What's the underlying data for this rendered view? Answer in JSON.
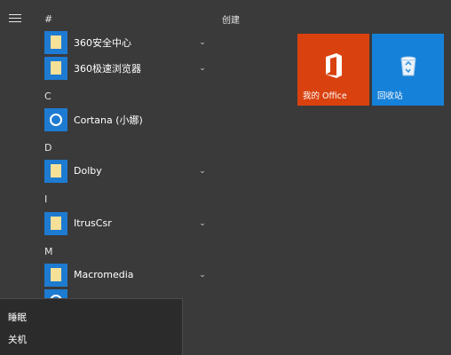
{
  "start": {
    "groups": [
      "#",
      "C",
      "D",
      "I",
      "M"
    ],
    "apps": [
      {
        "label": "360安全中心",
        "icon": "folder-icon",
        "expandable": true
      },
      {
        "label": "360极速浏览器",
        "icon": "folder-icon",
        "expandable": true
      },
      {
        "label": "Cortana (小娜)",
        "icon": "cortana-icon",
        "expandable": false
      },
      {
        "label": "Dolby",
        "icon": "folder-icon",
        "expandable": true
      },
      {
        "label": "ItrusCsr",
        "icon": "folder-icon",
        "expandable": true
      },
      {
        "label": "Macromedia",
        "icon": "folder-icon",
        "expandable": true
      }
    ],
    "section_title": "创建",
    "tiles": [
      {
        "label": "我的 Office",
        "color": "#d9420f",
        "icon": "office-icon"
      },
      {
        "label": "回收站",
        "color": "#1681d8",
        "icon": "recycle-bin-icon"
      }
    ],
    "power_menu": [
      {
        "label": "睡眠"
      },
      {
        "label": "关机"
      }
    ]
  }
}
